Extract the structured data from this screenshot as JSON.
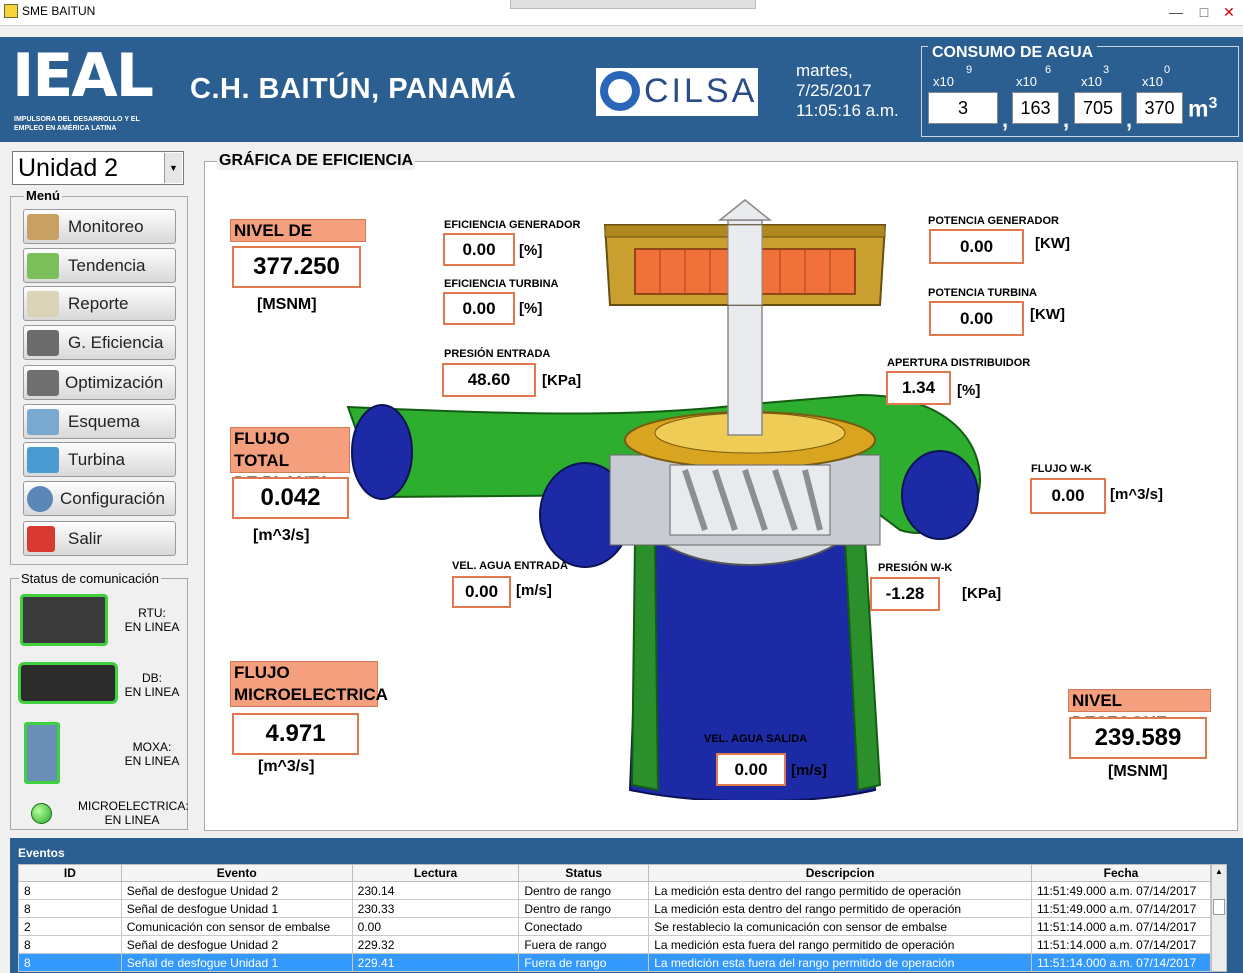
{
  "window": {
    "title": "SME BAITUN"
  },
  "header": {
    "logo": "IEAL",
    "logo_sub": "IMPULSORA DEL DESARROLLO Y EL EMPLEO EN AMÉRICA LATINA",
    "plant_name": "C.H.  BAITÚN,  PANAMÁ",
    "partner_logo": "CILSA",
    "day": "martes,",
    "date": "7/25/2017",
    "time": "11:05:16 a.m."
  },
  "consumo": {
    "label": "CONSUMO DE AGUA",
    "x10": "x10",
    "cells": [
      {
        "exp": "9",
        "value": "3"
      },
      {
        "exp": "6",
        "value": "163"
      },
      {
        "exp": "3",
        "value": "705"
      },
      {
        "exp": "0",
        "value": "370"
      }
    ],
    "comma": ",",
    "unit": "m",
    "unit_exp": "3"
  },
  "unit_selector": {
    "value": "Unidad 2"
  },
  "menu": {
    "label": "Menú",
    "items": [
      {
        "label": "Monitoreo",
        "color": "#c8a064"
      },
      {
        "label": "Tendencia",
        "color": "#7bbf5a"
      },
      {
        "label": "Reporte",
        "color": "#d9d3b8"
      },
      {
        "label": "G. Eficiencia",
        "color": "#6c6c6c"
      },
      {
        "label": "Optimización",
        "color": "#707070"
      },
      {
        "label": "Esquema",
        "color": "#7aa9cf"
      },
      {
        "label": "Turbina",
        "color": "#4a9bd1"
      },
      {
        "label": "Configuración",
        "color": "#5a86b8"
      },
      {
        "label": "Salir",
        "color": "#d83a32"
      }
    ]
  },
  "status": {
    "label": "Status de comunicación",
    "items": [
      {
        "name": "RTU:",
        "state": "EN LINEA"
      },
      {
        "name": "DB:",
        "state": "EN LINEA"
      },
      {
        "name": "MOXA:",
        "state": "EN LINEA"
      },
      {
        "name": "MICROELECTRICA:",
        "state": "EN LINEA"
      }
    ]
  },
  "chart": {
    "title": "GRÁFICA DE EFICIENCIA",
    "nivel_presa": {
      "label": "NIVEL DE PRESA",
      "value": "377.250",
      "unit": "[MSNM]"
    },
    "flujo_total": {
      "label1": "FLUJO TOTAL",
      "label2": "DE  PLANTA",
      "value": "0.042",
      "unit": "[m^3/s]"
    },
    "flujo_micro": {
      "label1": "FLUJO",
      "label2": "MICROELECTRICA",
      "value": "4.971",
      "unit": "[m^3/s]"
    },
    "ef_generador": {
      "label": "EFICIENCIA GENERADOR",
      "value": "0.00",
      "unit": "[%]"
    },
    "ef_turbina": {
      "label": "EFICIENCIA TURBINA",
      "value": "0.00",
      "unit": "[%]"
    },
    "presion_entrada": {
      "label": "PRESIÓN ENTRADA",
      "value": "48.60",
      "unit": "[KPa]"
    },
    "vel_entrada": {
      "label": "VEL. AGUA ENTRADA",
      "value": "0.00",
      "unit": "[m/s]"
    },
    "vel_salida": {
      "label": "VEL. AGUA SALIDA",
      "value": "0.00",
      "unit": "[m/s]"
    },
    "pot_generador": {
      "label": "POTENCIA GENERADOR",
      "value": "0.00",
      "unit": "[KW]"
    },
    "pot_turbina": {
      "label": "POTENCIA TURBINA",
      "value": "0.00",
      "unit": "[KW]"
    },
    "apertura": {
      "label": "APERTURA DISTRIBUIDOR",
      "value": "1.34",
      "unit": "[%]"
    },
    "flujo_wk": {
      "label": "FLUJO W-K",
      "value": "0.00",
      "unit": "[m^3/s]"
    },
    "presion_wk": {
      "label": "PRESIÓN W-K",
      "value": "-1.28",
      "unit": "[KPa]"
    },
    "nivel_desfogue": {
      "label": "NIVEL DESFOGUE",
      "value": "239.589",
      "unit": "[MSNM]"
    }
  },
  "events": {
    "label": "Eventos",
    "columns": [
      "ID",
      "Evento",
      "Lectura",
      "Status",
      "Descripcion",
      "Fecha"
    ],
    "rows": [
      [
        "8",
        "Señal de desfogue Unidad 2",
        "230.14",
        "Dentro de rango",
        "La medición esta dentro del rango permitido de operación",
        "11:51:49.000 a.m. 07/14/2017"
      ],
      [
        "8",
        "Señal de desfogue Unidad 1",
        "230.33",
        "Dentro de rango",
        "La medición esta dentro del rango permitido de operación",
        "11:51:49.000 a.m. 07/14/2017"
      ],
      [
        "2",
        "Comunicación con sensor de embalse",
        "0.00",
        "Conectado",
        "Se restablecio la comunicación con sensor de embalse",
        "11:51:14.000 a.m. 07/14/2017"
      ],
      [
        "8",
        "Señal de desfogue Unidad 2",
        "229.32",
        "Fuera de rango",
        "La medición esta fuera del rango permitido de operación",
        "11:51:14.000 a.m. 07/14/2017"
      ],
      [
        "8",
        "Señal de desfogue Unidad 1",
        "229.41",
        "Fuera de rango",
        "La medición esta fuera del rango permitido de operación",
        "11:51:14.000 a.m. 07/14/2017"
      ]
    ]
  }
}
